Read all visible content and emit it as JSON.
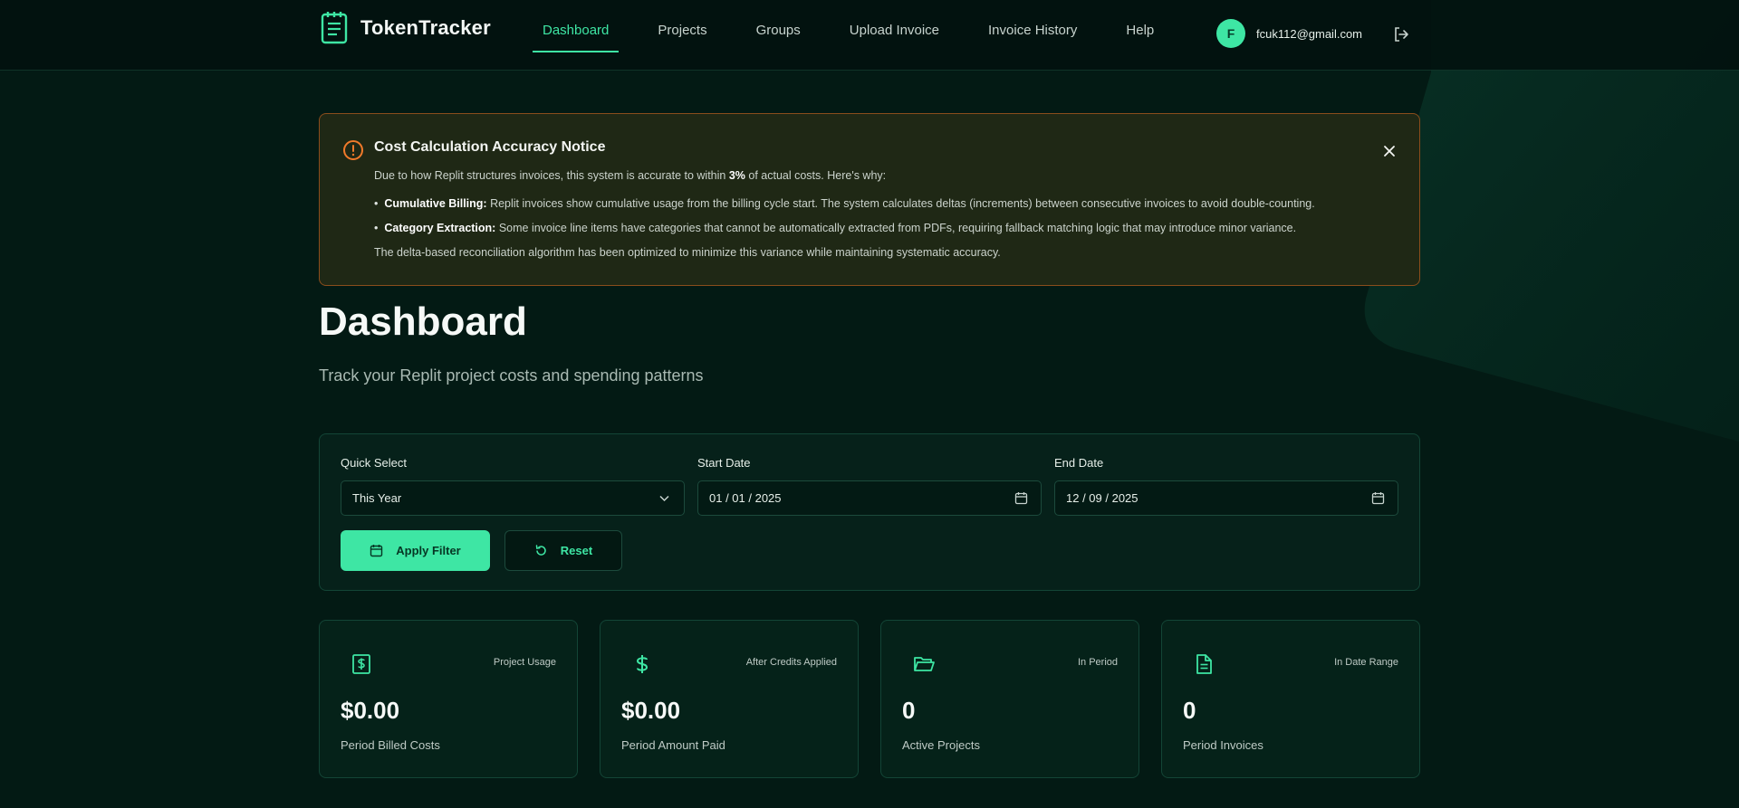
{
  "app": {
    "name": "TokenTracker"
  },
  "nav": {
    "items": [
      "Dashboard",
      "Projects",
      "Groups",
      "Upload Invoice",
      "Invoice History",
      "Help"
    ],
    "active": "Dashboard"
  },
  "user": {
    "initial": "F",
    "email": "fcuk112@gmail.com"
  },
  "notice": {
    "title": "Cost Calculation Accuracy Notice",
    "intro_pre": "Due to how Replit structures invoices, this system is accurate to within ",
    "intro_bold": "3%",
    "intro_post": " of actual costs. Here's why:",
    "bullet1_bold": "Cumulative Billing:",
    "bullet1_text": " Replit invoices show cumulative usage from the billing cycle start. The system calculates deltas (increments) between consecutive invoices to avoid double-counting.",
    "bullet2_bold": "Category Extraction:",
    "bullet2_text": " Some invoice line items have categories that cannot be automatically extracted from PDFs, requiring fallback matching logic that may introduce minor variance.",
    "footer": "The delta-based reconciliation algorithm has been optimized to minimize this variance while maintaining systematic accuracy."
  },
  "page": {
    "title": "Dashboard",
    "subtitle": "Track your Replit project costs and spending patterns"
  },
  "filter": {
    "quick_select_label": "Quick Select",
    "quick_select_value": "This Year",
    "start_label": "Start Date",
    "start_value": "01 / 01 / 2025",
    "end_label": "End Date",
    "end_value": "12 / 09 / 2025",
    "apply_label": "Apply Filter",
    "reset_label": "Reset"
  },
  "stats": [
    {
      "icon": "dollar-receipt-icon",
      "tag": "Project Usage",
      "value": "$0.00",
      "label": "Period Billed Costs"
    },
    {
      "icon": "dollar-icon",
      "tag": "After Credits Applied",
      "value": "$0.00",
      "label": "Period Amount Paid"
    },
    {
      "icon": "folder-icon",
      "tag": "In Period",
      "value": "0",
      "label": "Active Projects"
    },
    {
      "icon": "document-icon",
      "tag": "In Date Range",
      "value": "0",
      "label": "Period Invoices"
    }
  ],
  "colors": {
    "background": "#031a14",
    "accent": "#3ee6a4",
    "notice_border": "#8a4d1c",
    "notice_icon": "#f07a2a"
  }
}
